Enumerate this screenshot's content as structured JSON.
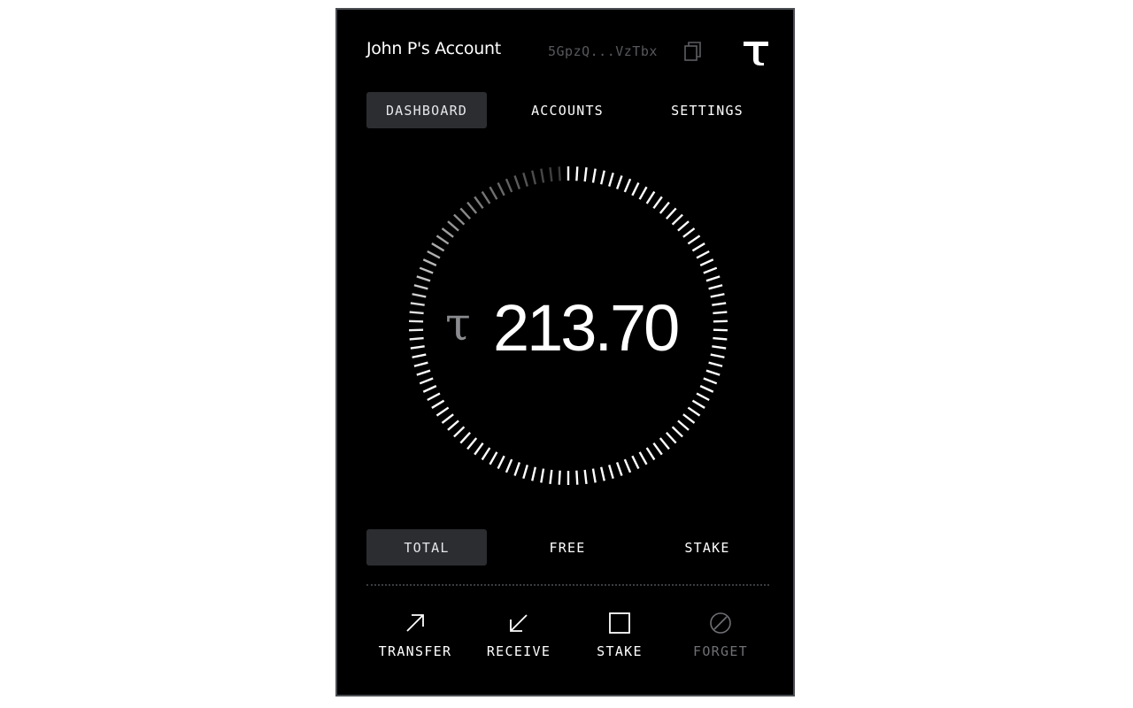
{
  "header": {
    "account_name": "John P's Account",
    "address": "5GpzQ...VzTbx",
    "copy_icon": "copy-icon",
    "logo_icon": "tau-logo-icon"
  },
  "nav": {
    "tabs": [
      {
        "label": "DASHBOARD",
        "active": true
      },
      {
        "label": "ACCOUNTS",
        "active": false
      },
      {
        "label": "SETTINGS",
        "active": false
      }
    ]
  },
  "balance": {
    "symbol": "τ",
    "value": "213.70"
  },
  "balance_filter": {
    "options": [
      {
        "label": "TOTAL",
        "active": true
      },
      {
        "label": "FREE",
        "active": false
      },
      {
        "label": "STAKE",
        "active": false
      }
    ]
  },
  "actions": [
    {
      "label": "TRANSFER",
      "icon": "arrow-up-right-icon",
      "enabled": true
    },
    {
      "label": "RECEIVE",
      "icon": "arrow-down-left-icon",
      "enabled": true
    },
    {
      "label": "STAKE",
      "icon": "square-icon",
      "enabled": true
    },
    {
      "label": "FORGET",
      "icon": "slash-circle-icon",
      "enabled": false
    }
  ],
  "colors": {
    "background": "#000000",
    "active_pill": "#2b2d31",
    "text": "#ffffff",
    "muted": "#56585c",
    "disabled": "#6e7075"
  }
}
